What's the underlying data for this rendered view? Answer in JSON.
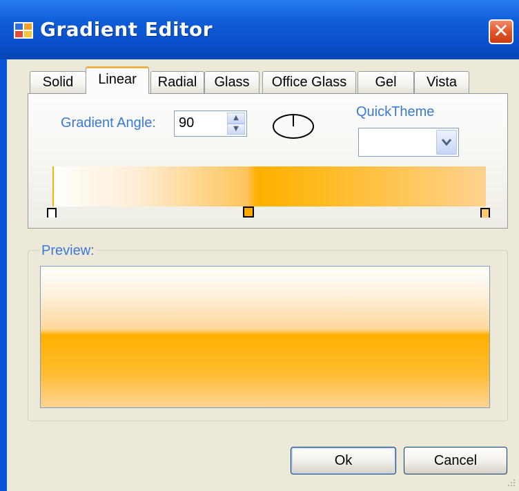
{
  "window": {
    "title": "Gradient Editor",
    "close_glyph": "✕"
  },
  "tabs": [
    {
      "label": "Solid",
      "active": false
    },
    {
      "label": "Linear",
      "active": true
    },
    {
      "label": "Radial",
      "active": false
    },
    {
      "label": "Glass",
      "active": false
    },
    {
      "label": "Office Glass",
      "active": false
    },
    {
      "label": "Gel",
      "active": false
    },
    {
      "label": "Vista",
      "active": false
    }
  ],
  "linear": {
    "angle_label": "Gradient Angle:",
    "angle_value": "90",
    "quicktheme_label": "QuickTheme",
    "quicktheme_value": "",
    "gradient_stops": [
      {
        "position": 0.0,
        "color": "#ffffff"
      },
      {
        "position": 0.46,
        "color": "#ffb000"
      },
      {
        "position": 1.0,
        "color": "#ffc870"
      }
    ]
  },
  "preview": {
    "label": "Preview:"
  },
  "buttons": {
    "ok": "Ok",
    "cancel": "Cancel"
  },
  "colors": {
    "accent_text": "#3a78d8",
    "titlebar": "#0a56d8",
    "gradient_mid": "#ffb000"
  }
}
